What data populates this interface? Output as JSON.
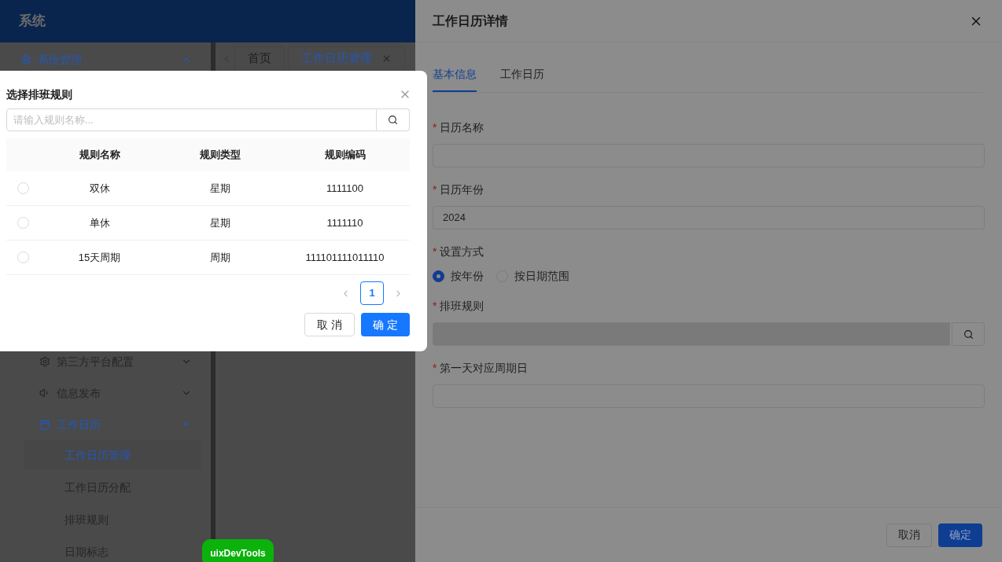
{
  "app": {
    "title": "系统",
    "sidebar": [
      {
        "label": "系统管理",
        "expanded": true,
        "selected": true
      },
      {
        "label": "第三方平台配置",
        "expanded": false,
        "selected": false
      },
      {
        "label": "信息发布",
        "expanded": false,
        "selected": false
      },
      {
        "label": "工作日历",
        "expanded": true,
        "selected": true,
        "children": [
          {
            "label": "工作日历管理",
            "selected": true
          },
          {
            "label": "工作日历分配",
            "selected": false
          },
          {
            "label": "排班规则",
            "selected": false
          },
          {
            "label": "日期标志",
            "selected": false
          }
        ]
      }
    ],
    "tabs": [
      {
        "label": "首页",
        "selected": false,
        "closable": false
      },
      {
        "label": "工作日历管理",
        "selected": true,
        "closable": true
      }
    ]
  },
  "drawer": {
    "title": "工作日历详情",
    "tabs": [
      {
        "label": "基本信息",
        "selected": true
      },
      {
        "label": "工作日历",
        "selected": false
      }
    ],
    "fields": [
      {
        "kind": "text",
        "label": "日历名称",
        "required_mark": "*"
      },
      {
        "kind": "text",
        "label": "日历年份",
        "required_mark": "*",
        "value": "2024"
      },
      {
        "kind": "radio",
        "label": "设置方式",
        "required_mark": "*",
        "options": [
          {
            "label": "按年份",
            "selected": true
          },
          {
            "label": "按日期范围",
            "selected": false
          }
        ]
      },
      {
        "kind": "search",
        "label": "排班规则",
        "required_mark": "*",
        "disabled": true
      },
      {
        "kind": "text",
        "label": "第一天对应周期日",
        "required_mark": "*"
      }
    ],
    "buttons": [
      {
        "label": "取消",
        "primary": false
      },
      {
        "label": "确定",
        "primary": true
      }
    ]
  },
  "modal": {
    "title": "选择排班规则",
    "search": {
      "placeholder": "请输入规则名称..."
    },
    "columns": [
      "规则名称",
      "规则类型",
      "规则编码"
    ],
    "rows": [
      {
        "selected": false,
        "cells": [
          "双休",
          "星期",
          "1111100"
        ]
      },
      {
        "selected": false,
        "cells": [
          "单休",
          "星期",
          "1111110"
        ]
      },
      {
        "selected": false,
        "cells": [
          "15天周期",
          "周期",
          "111101111011110"
        ]
      }
    ],
    "pages": [
      {
        "label": "1",
        "selected": true
      }
    ],
    "buttons": [
      {
        "label": "取 消",
        "primary": false
      },
      {
        "label": "确 定",
        "primary": true
      }
    ]
  },
  "devtools_badge": "uixDevTools"
}
